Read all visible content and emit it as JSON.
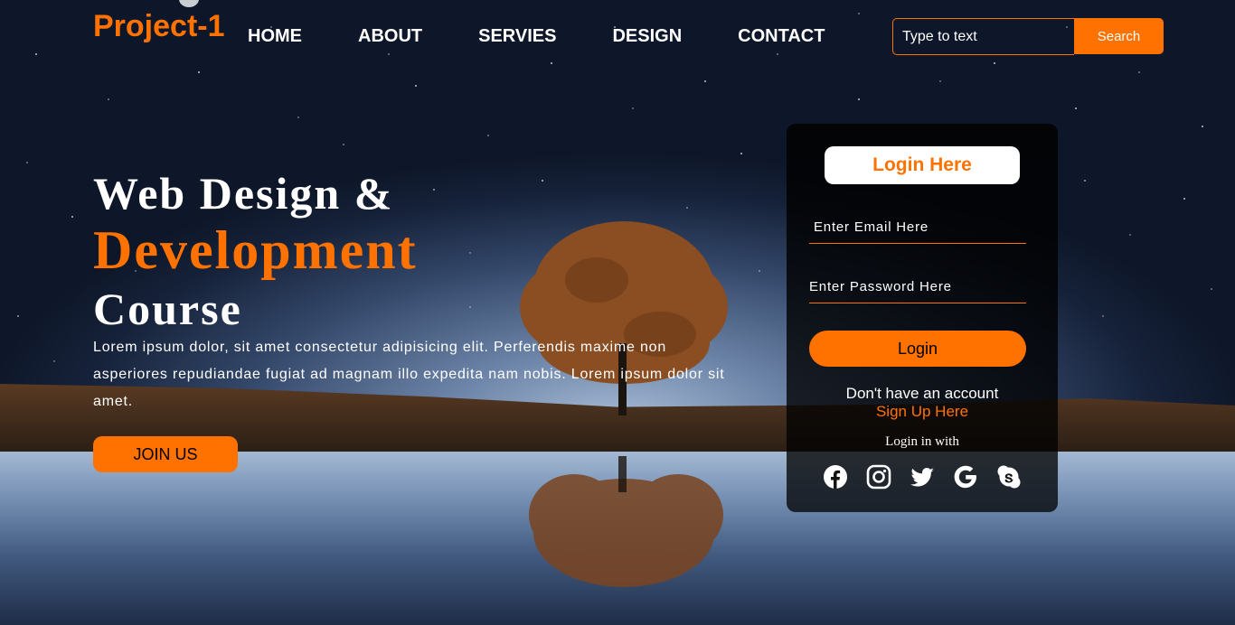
{
  "header": {
    "logo": "Project-1",
    "nav": [
      {
        "label": "HOME"
      },
      {
        "label": "ABOUT"
      },
      {
        "label": "SERVIES"
      },
      {
        "label": "DESIGN"
      },
      {
        "label": "CONTACT"
      }
    ],
    "search": {
      "placeholder": "Type to text",
      "button_label": "Search"
    }
  },
  "hero": {
    "line1": "Web Design &",
    "line2": "Development",
    "line3": "Course",
    "paragraph": "Lorem ipsum dolor, sit amet consectetur adipisicing elit. Perferendis maxime non asperiores repudiandae fugiat ad magnam illo expedita nam nobis. Lorem ipsum dolor sit amet.",
    "join_label": "JOIN US"
  },
  "login": {
    "title": "Login Here",
    "email_placeholder": "Enter Email Here",
    "password_placeholder": "Enter Password Here",
    "button_label": "Login",
    "no_account": "Don't have an account",
    "signup": "Sign Up Here",
    "login_with": "Login in with",
    "socials": [
      "facebook-icon",
      "instagram-icon",
      "twitter-icon",
      "google-icon",
      "skype-icon"
    ]
  },
  "colors": {
    "accent": "#ff7200",
    "panel": "#000000",
    "text": "#ffffff"
  }
}
